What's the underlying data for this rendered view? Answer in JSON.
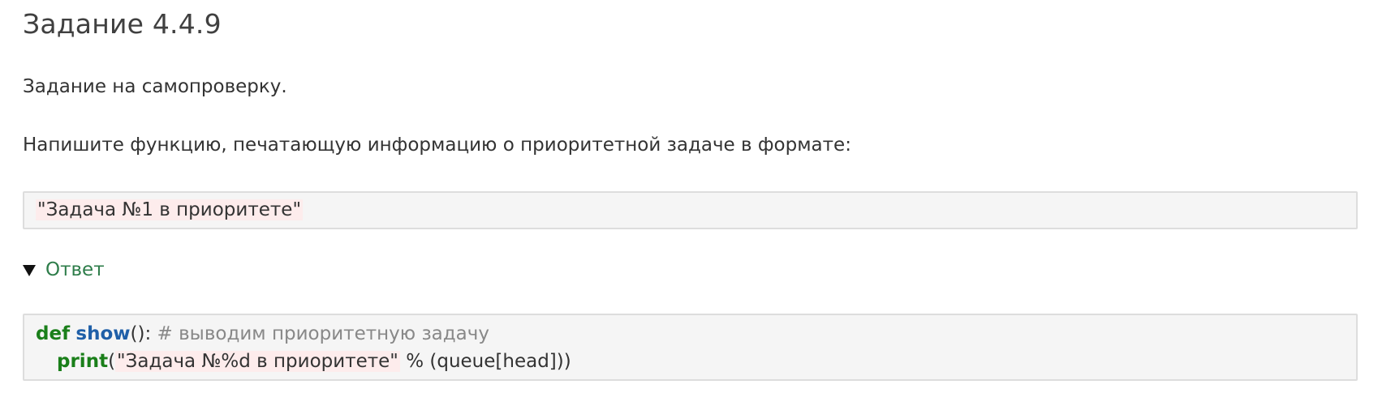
{
  "title": "Задание 4.4.9",
  "paragraph1": "Задание на самопроверку.",
  "paragraph2": "Напишите функцию, печатающую информацию о приоритетной задаче в формате:",
  "example_output": "\"Задача №1 в приоритете\"",
  "answer_toggle": {
    "label": "Ответ",
    "icon": "triangle-down-icon"
  },
  "code": {
    "line1": {
      "keyword": "def",
      "function_name": "show",
      "punct": "():",
      "comment": "# выводим приоритетную задачу"
    },
    "line2": {
      "keyword": "print",
      "open": "(",
      "string": "\"Задача №%d в приоритете\"",
      "rest": " % (queue[head]))"
    }
  },
  "colors": {
    "keyword": "#1a7f1a",
    "function": "#1f5fa8",
    "comment": "#888888",
    "link": "#2e7d4a",
    "string_highlight": "#fdecec",
    "code_background": "#f5f5f5"
  }
}
